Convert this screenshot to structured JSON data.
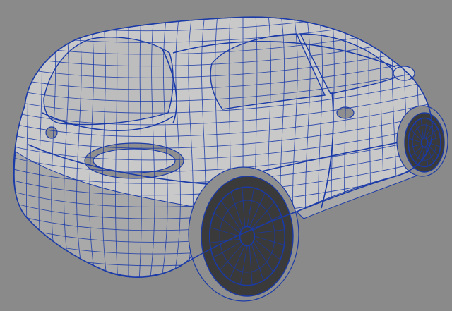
{
  "viewport": {
    "subject": "car-wireframe-model",
    "colors": {
      "background": "#8a8a8a",
      "body": "#c9c9c9",
      "body_shade": "#a9a9a9",
      "body_dark": "#8f8f8f",
      "glass": "#bdbdbd",
      "wire": "#1a3aa8",
      "tire": "#3a3a3a"
    }
  }
}
